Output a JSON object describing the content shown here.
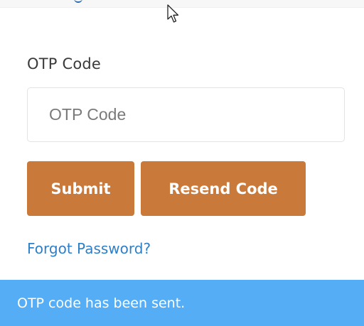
{
  "form": {
    "otp_label": "OTP Code",
    "otp_value": "",
    "otp_placeholder": "OTP Code",
    "submit_label": "Submit",
    "resend_label": "Resend Code",
    "forgot_link": "Forgot Password?"
  },
  "notification": {
    "message": "OTP code has been sent."
  },
  "colors": {
    "button_bg": "#c9793a",
    "link": "#2f7fc6",
    "alert_bg": "#55aef5"
  },
  "icons": {
    "cursor": "mouse-pointer-icon"
  }
}
